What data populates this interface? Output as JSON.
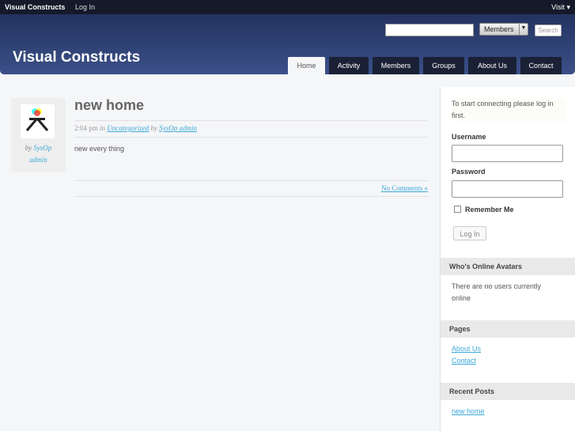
{
  "adminbar": {
    "brand": "Visual Constructs",
    "login": "Log In",
    "visit": "Visit ▾"
  },
  "header": {
    "title": "Visual Constructs",
    "search_value": "",
    "members_select": "Members",
    "search_button": "Search"
  },
  "nav": [
    "Home",
    "Activity",
    "Members",
    "Groups",
    "About Us",
    "Contact"
  ],
  "post": {
    "title": "new home",
    "time": "2:04 pm",
    "in": "in",
    "category": "Uncategorized",
    "by": "by",
    "author": "SysOp admin",
    "content": "new every thing",
    "comments": "No Comments »",
    "avatar_by": "by",
    "avatar_author1": "SysOp",
    "avatar_author2": "admin"
  },
  "sidebar": {
    "login_prompt": "To start connecting please log in first.",
    "username_label": "Username",
    "password_label": "Password",
    "remember_label": "Remember Me",
    "login_button": "Log In",
    "online_title": "Who's Online Avatars",
    "online_text": "There are no users currently online",
    "pages_title": "Pages",
    "pages": [
      "About Us",
      "Contact"
    ],
    "recent_title": "Recent Posts",
    "recent": [
      "new home"
    ]
  }
}
